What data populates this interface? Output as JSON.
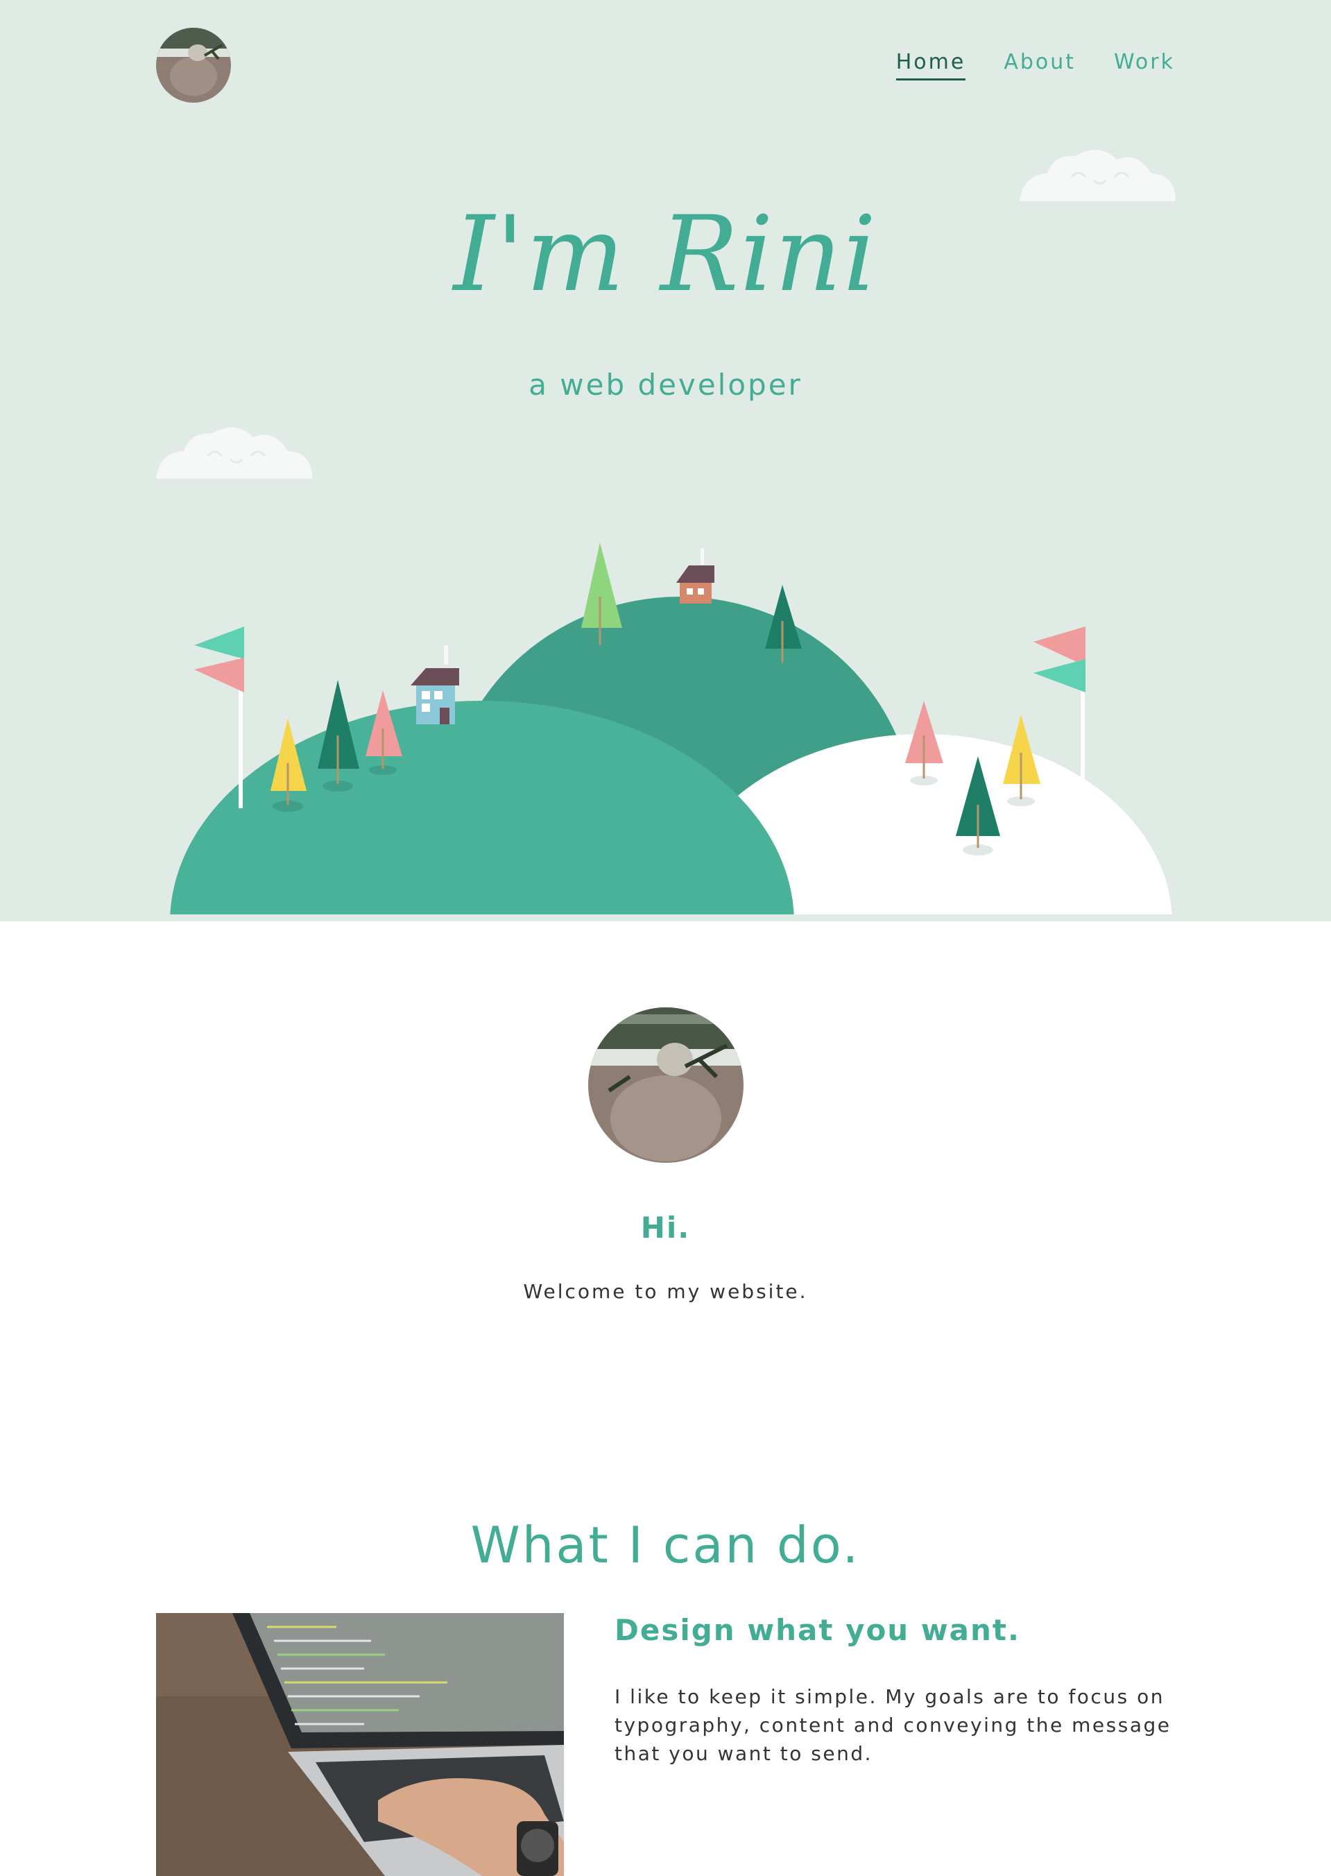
{
  "header": {
    "logo_alt": "profile photo",
    "nav": [
      {
        "label": "Home",
        "active": true
      },
      {
        "label": "About",
        "active": false
      },
      {
        "label": "Work",
        "active": false
      }
    ]
  },
  "hero": {
    "title": "I'm Rini",
    "subtitle": "a web developer"
  },
  "intro": {
    "greeting": "Hi.",
    "welcome": "Welcome to my website."
  },
  "services": {
    "title": "What I can do.",
    "items": [
      {
        "heading": "Design what you want.",
        "body": "I like to keep it simple. My goals are to focus on typography, content and conveying the message that you want to send."
      }
    ]
  },
  "colors": {
    "accent": "#42ad94",
    "hero_bg": "#e1ebe6",
    "hill_front": "#4bb29a",
    "hill_back": "#3f9f88",
    "snow": "#ffffff",
    "nav_active": "#1f5e4c"
  }
}
